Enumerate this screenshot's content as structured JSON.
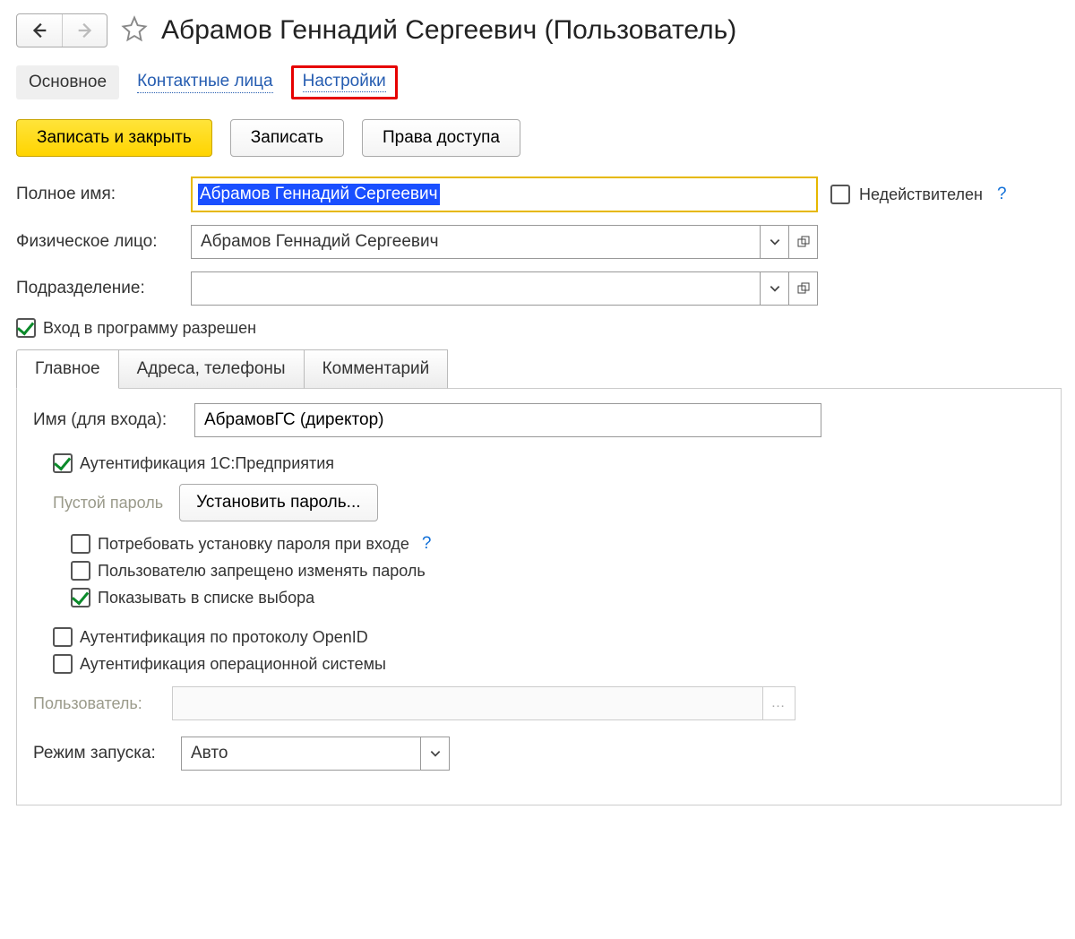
{
  "page_title": "Абрамов Геннадий Сергеевич (Пользователь)",
  "main_tabs": {
    "main": "Основное",
    "contacts": "Контактные лица",
    "settings": "Настройки"
  },
  "actions": {
    "save_close": "Записать и закрыть",
    "save": "Записать",
    "access_rights": "Права доступа"
  },
  "form": {
    "full_name_label": "Полное имя:",
    "full_name_value": "Абрамов Геннадий Сергеевич",
    "invalid_label": "Недействителен",
    "invalid_checked": false,
    "person_label": "Физическое лицо:",
    "person_value": "Абрамов Геннадий Сергеевич",
    "department_label": "Подразделение:",
    "department_value": "",
    "login_allowed_label": "Вход в программу разрешен",
    "login_allowed_checked": true
  },
  "subtabs": {
    "main": "Главное",
    "contacts": "Адреса, телефоны",
    "comment": "Комментарий"
  },
  "login": {
    "login_name_label": "Имя (для входа):",
    "login_name_value": "АбрамовГС (директор)",
    "auth_1c_label": "Аутентификация 1С:Предприятия",
    "auth_1c_checked": true,
    "empty_password_label": "Пустой пароль",
    "set_password_btn": "Установить пароль...",
    "require_password_label": "Потребовать установку пароля при входе",
    "require_password_checked": false,
    "no_change_password_label": "Пользователю запрещено изменять пароль",
    "no_change_password_checked": false,
    "show_in_list_label": "Показывать в списке выбора",
    "show_in_list_checked": true,
    "auth_openid_label": "Аутентификация по протоколу OpenID",
    "auth_openid_checked": false,
    "auth_os_label": "Аутентификация операционной системы",
    "auth_os_checked": false,
    "os_user_label": "Пользователь:",
    "os_user_value": "",
    "start_mode_label": "Режим запуска:",
    "start_mode_value": "Авто"
  },
  "help": "?"
}
